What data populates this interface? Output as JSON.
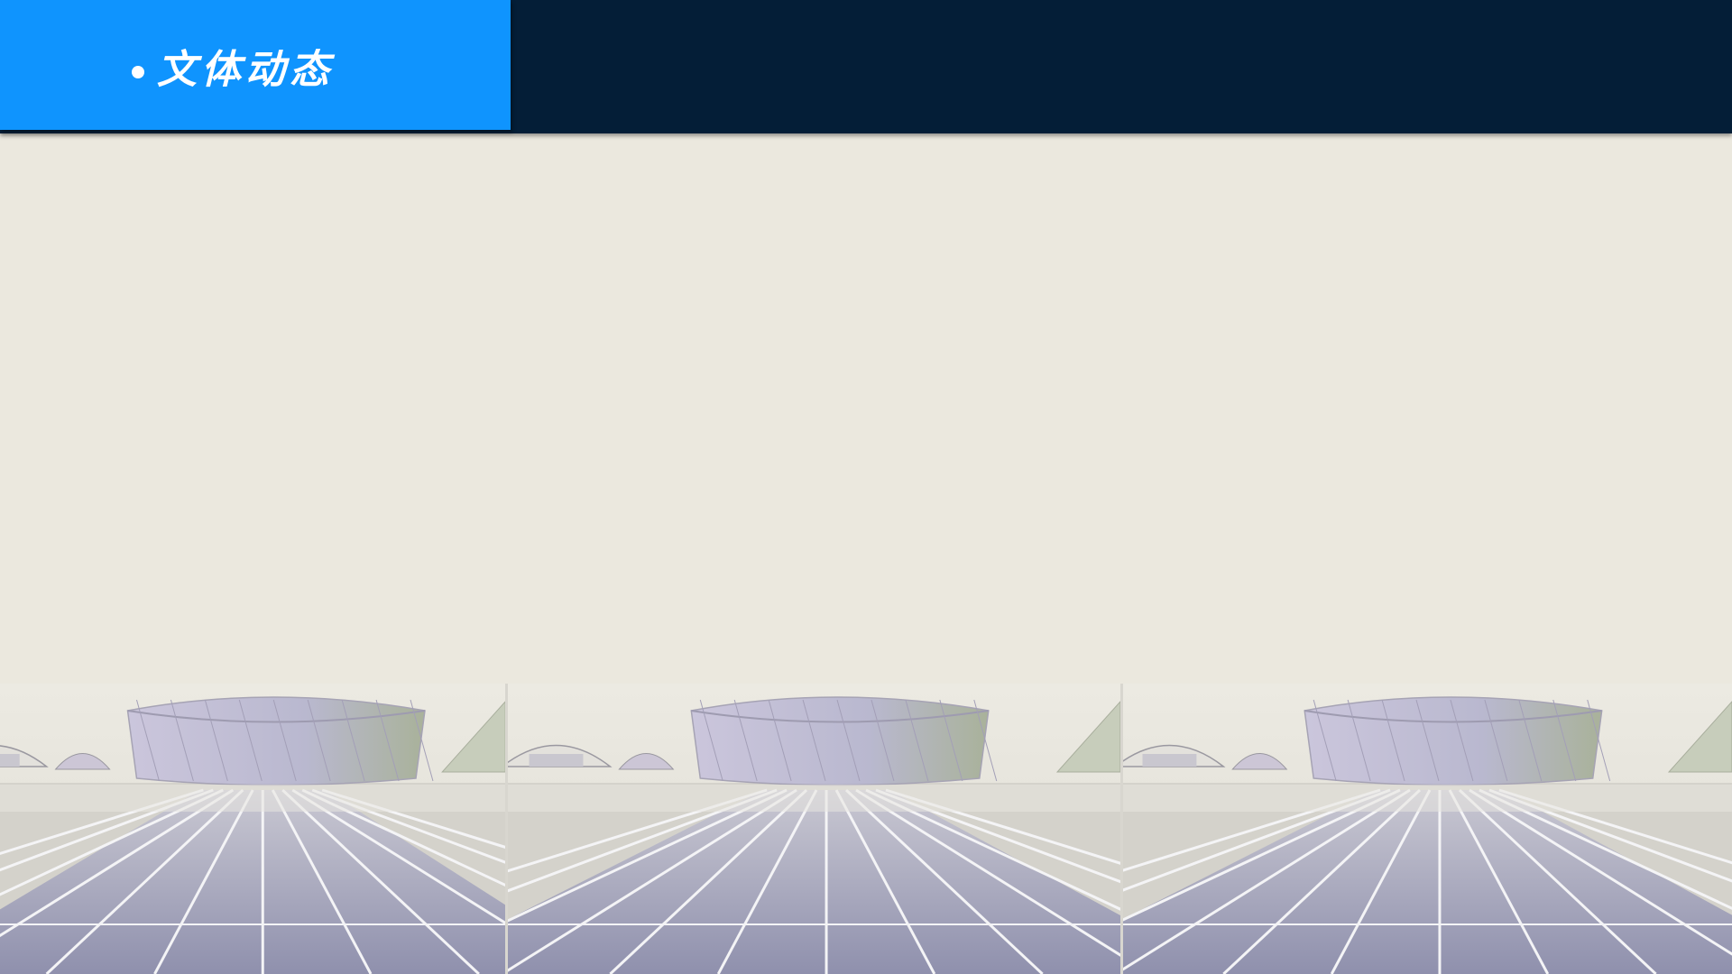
{
  "header": {
    "title": "文体动态",
    "colors": {
      "tab": "#0f94fe",
      "bar": "#041e37",
      "background": "#ebe8de"
    }
  },
  "banner": {
    "image": "stadium-running-track",
    "panel_count": 3
  }
}
